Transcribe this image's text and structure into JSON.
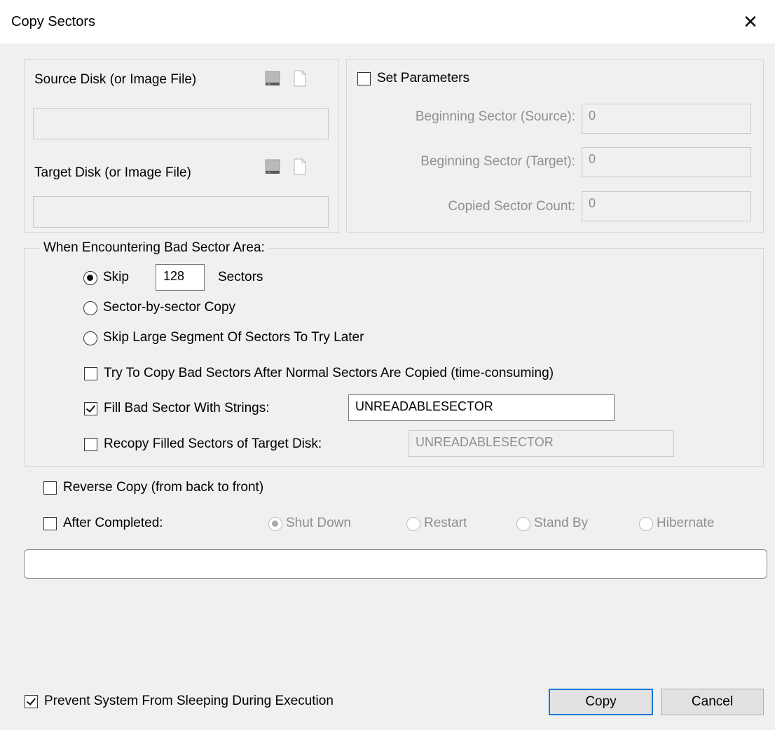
{
  "window": {
    "title": "Copy Sectors",
    "close_glyph": "✕"
  },
  "source": {
    "label": "Source Disk (or Image File)",
    "value": "",
    "icons": [
      "disk-icon",
      "file-icon"
    ]
  },
  "target": {
    "label": "Target Disk (or Image File)",
    "value": "",
    "icons": [
      "disk-icon",
      "file-icon"
    ]
  },
  "parameters": {
    "checkbox_label": "Set Parameters",
    "checked": false,
    "begin_source_label": "Beginning Sector (Source):",
    "begin_source_value": "0",
    "begin_target_label": "Beginning Sector (Target):",
    "begin_target_value": "0",
    "count_label": "Copied Sector Count:",
    "count_value": "0"
  },
  "bad_sector": {
    "legend": "When Encountering Bad Sector Area:",
    "skip_label": "Skip",
    "skip_value": "128",
    "skip_unit": "Sectors",
    "sector_by_sector_label": "Sector-by-sector Copy",
    "skip_large_label": "Skip Large Segment Of Sectors To Try Later",
    "selected_option": "skip",
    "try_copy_label": "Try To Copy Bad Sectors After Normal Sectors Are Copied (time-consuming)",
    "try_copy_checked": false,
    "fill_label": "Fill Bad Sector With Strings:",
    "fill_checked": true,
    "fill_value": "UNREADABLESECTOR",
    "recopy_label": "Recopy Filled Sectors of Target Disk:",
    "recopy_checked": false,
    "recopy_value": "UNREADABLESECTOR"
  },
  "reverse": {
    "label": "Reverse Copy (from back to front)",
    "checked": false
  },
  "after": {
    "label": "After Completed:",
    "checked": false,
    "options": [
      "Shut Down",
      "Restart",
      "Stand By",
      "Hibernate"
    ],
    "selected": "Shut Down"
  },
  "progress": {
    "value": 0
  },
  "footer": {
    "prevent_sleep_label": "Prevent System From Sleeping During Execution",
    "prevent_sleep_checked": true,
    "copy_label": "Copy",
    "cancel_label": "Cancel"
  }
}
